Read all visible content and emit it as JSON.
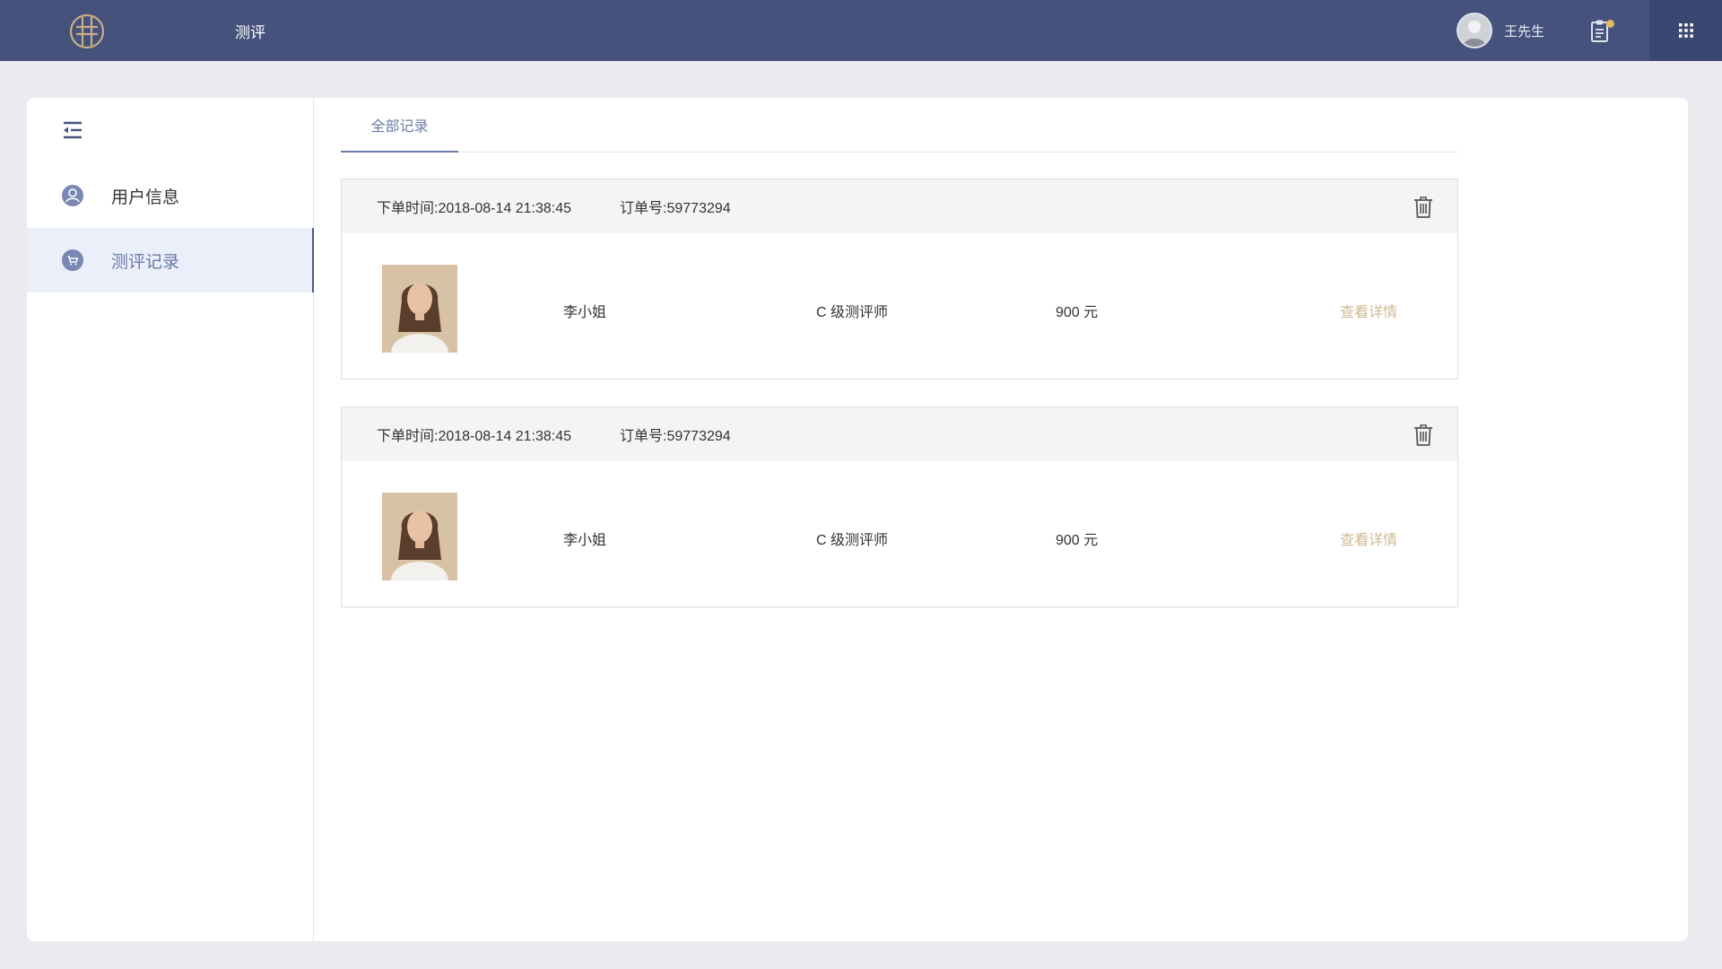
{
  "header": {
    "title": "测评",
    "user_name": "王先生",
    "notification_count": "1"
  },
  "sidebar": {
    "items": [
      {
        "label": "用户信息",
        "icon": "user-icon",
        "active": false
      },
      {
        "label": "测评记录",
        "icon": "cart-icon",
        "active": true
      }
    ]
  },
  "tabs": [
    {
      "label": "全部记录",
      "active": true
    }
  ],
  "orders": [
    {
      "time_label": "下单时间:",
      "time": "2018-08-14 21:38:45",
      "order_no_label": "订单号:",
      "order_no": "59773294",
      "name": "李小姐",
      "level": "C 级测评师",
      "price": "900 元",
      "action": "查看详情"
    },
    {
      "time_label": "下单时间:",
      "time": "2018-08-14 21:38:45",
      "order_no_label": "订单号:",
      "order_no": "59773294",
      "name": "李小姐",
      "level": "C 级测评师",
      "price": "900 元",
      "action": "查看详情"
    }
  ],
  "colors": {
    "header_bg": "#44527c",
    "accent": "#6b7aa8",
    "link": "#d1b892",
    "sidebar_active_bg": "#eaeff9"
  }
}
